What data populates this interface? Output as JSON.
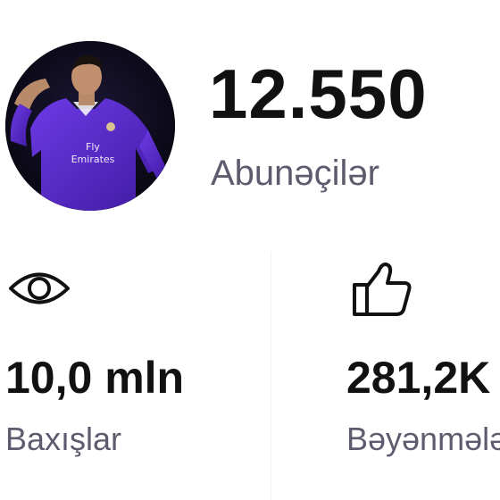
{
  "profile": {
    "avatar_icon": "player-photo",
    "subscribers_count": "12.550",
    "subscribers_label": "Abunəçilər"
  },
  "stats": {
    "views": {
      "icon": "eye-icon",
      "value": "10,0 mln",
      "label": "Baxışlar"
    },
    "likes": {
      "icon": "thumbs-up-icon",
      "value": "281,2K",
      "label": "Bəyənmələr"
    }
  },
  "colors": {
    "background": "#ffffff",
    "value_text": "#111111",
    "label_text": "#5f5b6e",
    "avatar_jersey": "#5b2bd0"
  }
}
